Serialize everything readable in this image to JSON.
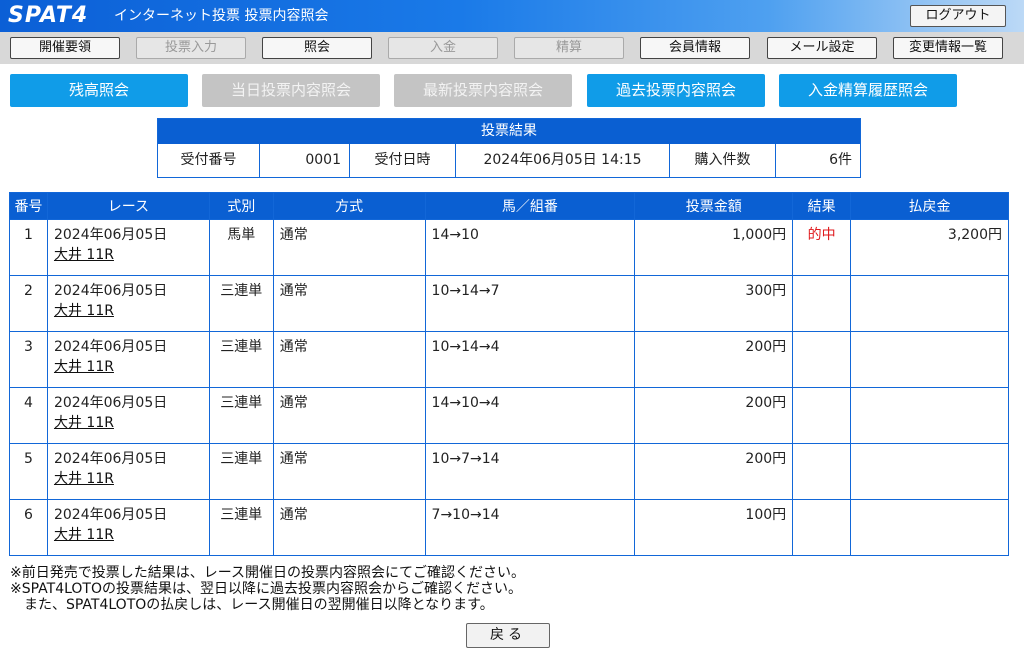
{
  "header": {
    "logo": "SPAT4",
    "title": "インターネット投票 投票内容照会",
    "logout_label": "ログアウト"
  },
  "nav": {
    "items": [
      {
        "label": "開催要領",
        "enabled": true
      },
      {
        "label": "投票入力",
        "enabled": false
      },
      {
        "label": "照会",
        "enabled": true
      },
      {
        "label": "入金",
        "enabled": false
      },
      {
        "label": "精算",
        "enabled": false
      },
      {
        "label": "会員情報",
        "enabled": true
      },
      {
        "label": "メール設定",
        "enabled": true
      },
      {
        "label": "変更情報一覧",
        "enabled": true
      }
    ]
  },
  "subtabs": [
    {
      "label": "残高照会",
      "enabled": true
    },
    {
      "label": "当日投票内容照会",
      "enabled": false
    },
    {
      "label": "最新投票内容照会",
      "enabled": false
    },
    {
      "label": "過去投票内容照会",
      "enabled": true
    },
    {
      "label": "入金精算履歴照会",
      "enabled": true
    }
  ],
  "summary": {
    "title": "投票結果",
    "receipt_label": "受付番号",
    "receipt_value": "0001",
    "datetime_label": "受付日時",
    "datetime_value": "2024年06月05日 14:15",
    "count_label": "購入件数",
    "count_value": "6件"
  },
  "results": {
    "headers": [
      "番号",
      "レース",
      "式別",
      "方式",
      "馬／組番",
      "投票金額",
      "結果",
      "払戻金"
    ],
    "rows": [
      {
        "no": "1",
        "date": "2024年06月05日",
        "race": "大井 11R",
        "type": "馬単",
        "method": "通常",
        "combo": "14→10",
        "amount": "1,000円",
        "result": "的中",
        "payout": "3,200円"
      },
      {
        "no": "2",
        "date": "2024年06月05日",
        "race": "大井 11R",
        "type": "三連単",
        "method": "通常",
        "combo": "10→14→7",
        "amount": "300円",
        "result": "",
        "payout": ""
      },
      {
        "no": "3",
        "date": "2024年06月05日",
        "race": "大井 11R",
        "type": "三連単",
        "method": "通常",
        "combo": "10→14→4",
        "amount": "200円",
        "result": "",
        "payout": ""
      },
      {
        "no": "4",
        "date": "2024年06月05日",
        "race": "大井 11R",
        "type": "三連単",
        "method": "通常",
        "combo": "14→10→4",
        "amount": "200円",
        "result": "",
        "payout": ""
      },
      {
        "no": "5",
        "date": "2024年06月05日",
        "race": "大井 11R",
        "type": "三連単",
        "method": "通常",
        "combo": "10→7→14",
        "amount": "200円",
        "result": "",
        "payout": ""
      },
      {
        "no": "6",
        "date": "2024年06月05日",
        "race": "大井 11R",
        "type": "三連単",
        "method": "通常",
        "combo": "7→10→14",
        "amount": "100円",
        "result": "",
        "payout": ""
      }
    ]
  },
  "notes": [
    "※前日発売で投票した結果は、レース開催日の投票内容照会にてご確認ください。",
    "※SPAT4LOTOの投票結果は、翌日以降に過去投票内容照会からご確認ください。",
    "　また、SPAT4LOTOの払戻しは、レース開催日の翌開催日以降となります。"
  ],
  "back_label": "戻る",
  "colors": {
    "header_blue": "#0b5fd6",
    "table_blue": "#0a5fd2",
    "tab_blue": "#109ce8",
    "hit_red": "#e0191c"
  }
}
